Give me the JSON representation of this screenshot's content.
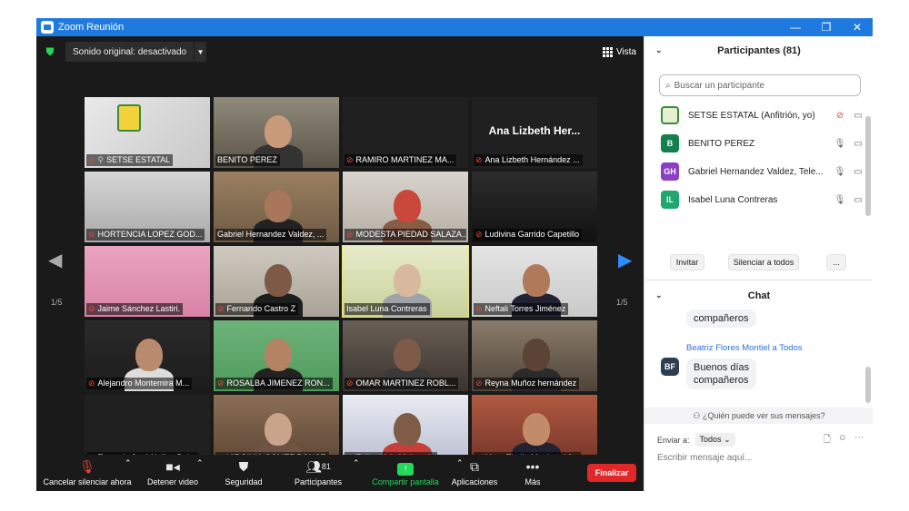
{
  "window": {
    "title": "Zoom Reunión",
    "minimize": "—",
    "maximize": "❐",
    "close": "✕"
  },
  "topbar": {
    "audio_label": "Sonido original: desactivado",
    "view_label": "Vista"
  },
  "tiles": [
    {
      "name": "SETSE ESTATAL",
      "muted": true,
      "pinned": true,
      "video": true
    },
    {
      "name": "BENITO PEREZ",
      "muted": false,
      "video": true
    },
    {
      "name": "RAMIRO MARTINEZ MA...",
      "muted": true,
      "video": false
    },
    {
      "name": "Ana Lizbeth Hernández ...",
      "muted": true,
      "video": false,
      "display_name": "Ana Lizbeth Her..."
    },
    {
      "name": "HORTENCIA LOPEZ GOD...",
      "muted": true,
      "video": true
    },
    {
      "name": "Gabriel Hernandez Valdez, ...",
      "muted": false,
      "video": true
    },
    {
      "name": "MODESTA PIEDAD SALAZA...",
      "muted": true,
      "video": true
    },
    {
      "name": "Ludivina Garrido Capetillo",
      "muted": true,
      "video": true
    },
    {
      "name": "Jaime Sánchez Lastiri.",
      "muted": true,
      "video": true
    },
    {
      "name": "Fernando Castro Z",
      "muted": true,
      "video": true
    },
    {
      "name": "Isabel Luna Contreras",
      "muted": false,
      "video": true,
      "active_speaker": true
    },
    {
      "name": "Neftali Torres Jiménez",
      "muted": true,
      "video": true
    },
    {
      "name": "Alejandro Montemira M...",
      "muted": true,
      "video": true
    },
    {
      "name": "ROSALBA JIMENEZ RON...",
      "muted": true,
      "video": true
    },
    {
      "name": "OMAR MARTINEZ ROBL...",
      "muted": true,
      "video": true
    },
    {
      "name": "Reyna Muñoz hernández",
      "muted": true,
      "video": true
    },
    {
      "name": "Eustacio José Nuñez Bal...",
      "muted": true,
      "video": false
    },
    {
      "name": "VIRGINIA GOMEZ PONCE",
      "muted": true,
      "video": true
    },
    {
      "name": "Felipe Vela Melgarejo",
      "muted": true,
      "video": true
    },
    {
      "name": "Mtra. Elodia Martinez Vi...",
      "muted": true,
      "video": true
    }
  ],
  "pagination": {
    "left": "1/5",
    "right": "1/5"
  },
  "toolbar": {
    "unmute": "Cancelar silenciar ahora",
    "stop_video": "Detener video",
    "security": "Seguridad",
    "participants": "Participantes",
    "participants_count": "81",
    "share": "Compartir pantalla",
    "apps": "Aplicaciones",
    "more": "Más",
    "end": "Finalizar"
  },
  "participants_panel": {
    "title": "Participantes (81)",
    "search_placeholder": "Buscar un participante",
    "list": [
      {
        "name": "SETSE ESTATAL (Anfitrión, yo)",
        "initials": "",
        "color": "#e6f0d0",
        "muted": true
      },
      {
        "name": "BENITO PEREZ",
        "initials": "B",
        "color": "#137f4a",
        "muted": false
      },
      {
        "name": "Gabriel Hernandez Valdez, Tele...",
        "initials": "GH",
        "color": "#8a3fc4",
        "muted": false
      },
      {
        "name": "Isabel Luna Contreras",
        "initials": "IL",
        "color": "#1fa76e",
        "muted": false
      }
    ],
    "invite": "Invitar",
    "mute_all": "Silenciar a todos",
    "more": "..."
  },
  "chat": {
    "title": "Chat",
    "prev_message": "compañeros",
    "sender": "Beatriz Flores Montiel a Todos",
    "sender_initials": "BF",
    "message_line1": "Buenos días",
    "message_line2": "compañeros",
    "who_can_see": "¿Quién puede ver sus mensajes?",
    "send_to_label": "Enviar a:",
    "send_to_value": "Todos",
    "input_placeholder": "Escribir mensaje aquí..."
  }
}
